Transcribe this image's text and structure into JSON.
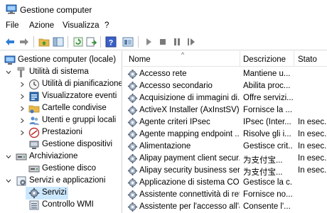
{
  "window": {
    "title": "Gestione computer"
  },
  "menu": [
    "File",
    "Azione",
    "Visualizza",
    "?"
  ],
  "toolbar": {
    "icons": [
      "back-arrow-icon",
      "forward-arrow-icon",
      "up-folder-icon",
      "show-hide-tree-icon",
      "refresh-icon",
      "export-list-icon",
      "help-icon",
      "properties-icon",
      "play-icon",
      "stop-icon",
      "pause-icon",
      "restart-icon"
    ]
  },
  "tree": {
    "root": "Gestione computer (locale)",
    "items": [
      {
        "label": "Utilità di sistema"
      },
      {
        "label": "Utilità di pianificazione"
      },
      {
        "label": "Visualizzatore eventi"
      },
      {
        "label": "Cartelle condivise"
      },
      {
        "label": "Utenti e gruppi locali"
      },
      {
        "label": "Prestazioni"
      },
      {
        "label": "Gestione dispositivi"
      },
      {
        "label": "Archiviazione"
      },
      {
        "label": "Gestione disco"
      },
      {
        "label": "Servizi e applicazioni"
      },
      {
        "label": "Servizi"
      },
      {
        "label": "Controllo WMI"
      }
    ],
    "selected": "Servizi"
  },
  "services": {
    "columns": {
      "name": "Nome",
      "description": "Descrizione",
      "state": "Stato"
    },
    "rows": [
      {
        "name": "Accesso rete",
        "description": "Mantiene u...",
        "state": ""
      },
      {
        "name": "Accesso secondario",
        "description": "Abilita proc...",
        "state": ""
      },
      {
        "name": "Acquisizione di immagini di...",
        "description": "Offre servizi...",
        "state": ""
      },
      {
        "name": "ActiveX Installer (AxInstSV)",
        "description": "Fornisce la ...",
        "state": ""
      },
      {
        "name": "Agente criteri IPsec",
        "description": "IPsec (Inter...",
        "state": "In esec..."
      },
      {
        "name": "Agente mapping endpoint ...",
        "description": "Risolve gli i...",
        "state": "In esec..."
      },
      {
        "name": "Alimentazione",
        "description": "Gestisce crit...",
        "state": "In esec..."
      },
      {
        "name": "Alipay payment client secur...",
        "description": "为支付宝...",
        "state": "In esec..."
      },
      {
        "name": "Alipay security business ser...",
        "description": "为支付宝...",
        "state": "In esec..."
      },
      {
        "name": "Applicazione di sistema CO...",
        "description": "Gestisce la c...",
        "state": ""
      },
      {
        "name": "Assistente connettività di rete",
        "description": "Fornisce no...",
        "state": ""
      },
      {
        "name": "Assistente per l'accesso all'a...",
        "description": "Consente l'...",
        "state": ""
      }
    ]
  }
}
